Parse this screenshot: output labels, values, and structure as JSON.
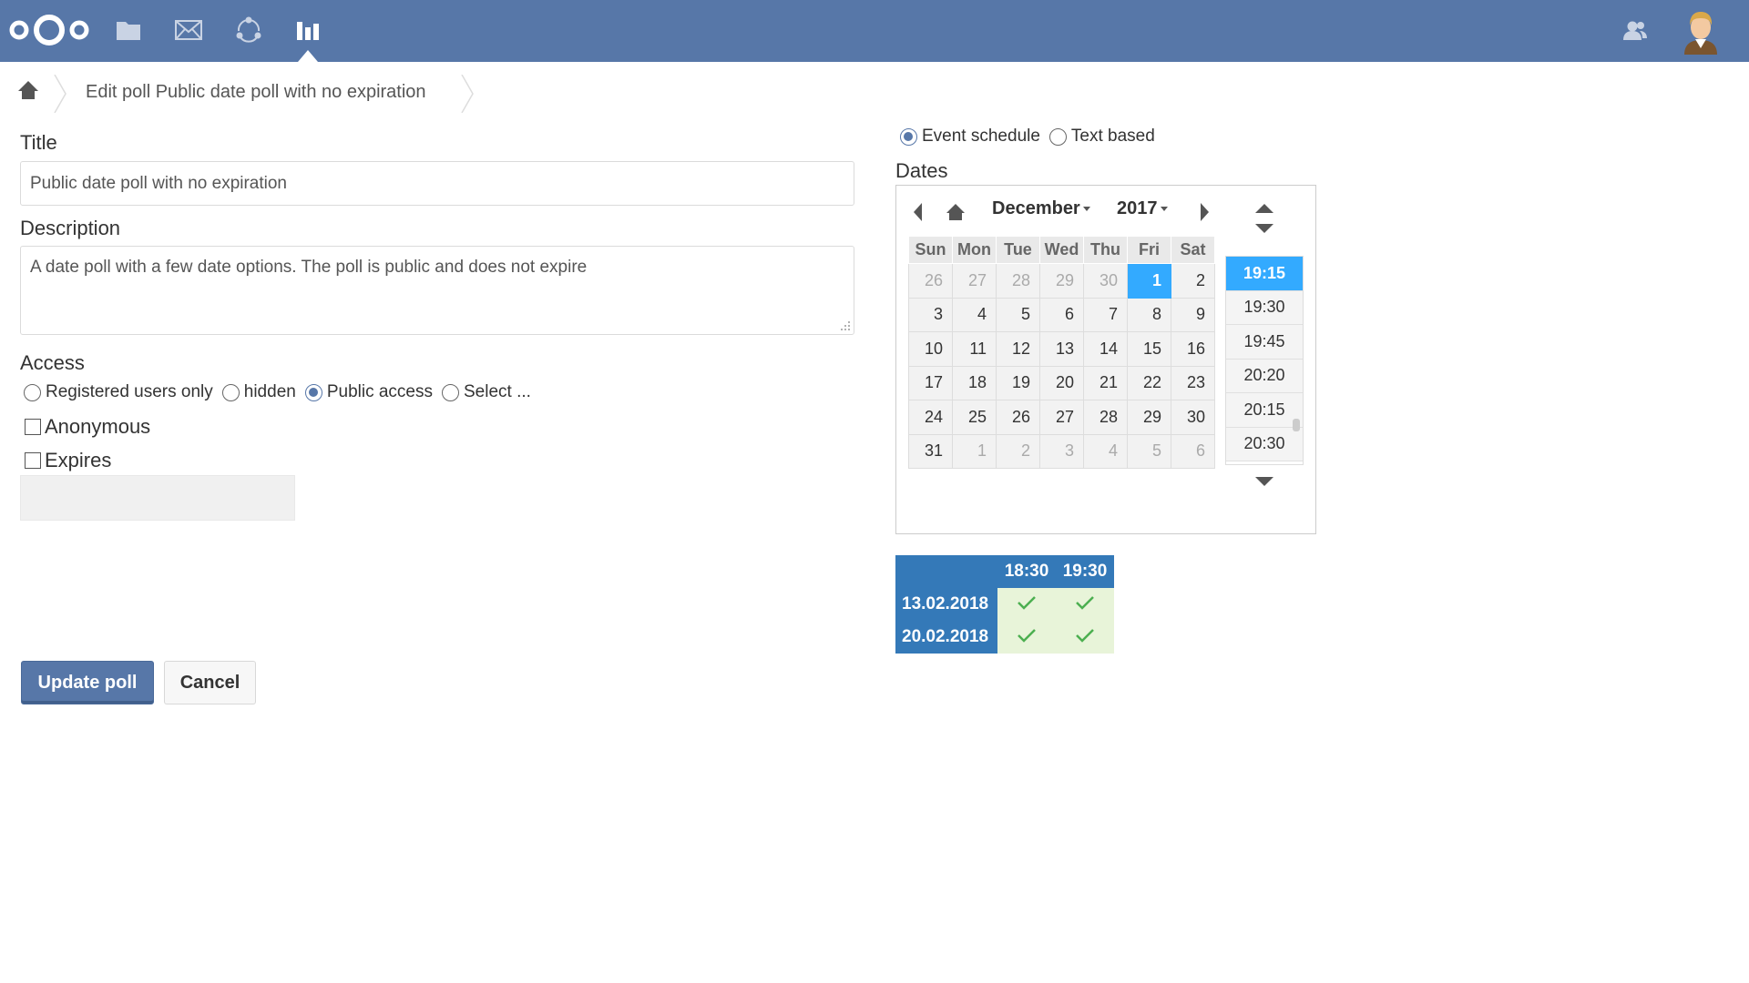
{
  "header": {
    "apps": [
      {
        "name": "Files",
        "icon": "folder-icon"
      },
      {
        "name": "Mail",
        "icon": "mail-icon"
      },
      {
        "name": "Circles",
        "icon": "circles-icon"
      },
      {
        "name": "Polls",
        "icon": "polls-icon",
        "active": true
      }
    ],
    "colors": {
      "header_bg": "#5777a8",
      "accent": "#0082c9",
      "selection": "#33aaff",
      "summary_bg": "#3479b8",
      "ok_bg": "#e8f4d9",
      "ok_check": "#4caf50"
    }
  },
  "breadcrumb": {
    "title": "Edit poll Public date poll with no expiration"
  },
  "form": {
    "title_label": "Title",
    "title_value": "Public date poll with no expiration",
    "description_label": "Description",
    "description_value": "A date poll with a few date options. The poll is public and does not expire",
    "access_label": "Access",
    "access_options": [
      "Registered users only",
      "hidden",
      "Public access",
      "Select ..."
    ],
    "access_selected": "Public access",
    "anonymous_label": "Anonymous",
    "anonymous_checked": false,
    "expires_label": "Expires",
    "expires_checked": false,
    "update_button": "Update poll",
    "cancel_button": "Cancel"
  },
  "poll_type": {
    "options": [
      "Event schedule",
      "Text based"
    ],
    "selected": "Event schedule"
  },
  "dates": {
    "label": "Dates",
    "month": "December",
    "year": "2017",
    "weekdays": [
      "Sun",
      "Mon",
      "Tue",
      "Wed",
      "Thu",
      "Fri",
      "Sat"
    ],
    "weeks": [
      [
        "26",
        "27",
        "28",
        "29",
        "30",
        "1",
        "2"
      ],
      [
        "3",
        "4",
        "5",
        "6",
        "7",
        "8",
        "9"
      ],
      [
        "10",
        "11",
        "12",
        "13",
        "14",
        "15",
        "16"
      ],
      [
        "17",
        "18",
        "19",
        "20",
        "21",
        "22",
        "23"
      ],
      [
        "24",
        "25",
        "26",
        "27",
        "28",
        "29",
        "30"
      ],
      [
        "31",
        "1",
        "2",
        "3",
        "4",
        "5",
        "6"
      ]
    ],
    "selected_day": "1",
    "times": [
      "19:15",
      "19:30",
      "19:45",
      "20:20",
      "20:15",
      "20:30"
    ],
    "selected_time": "19:15"
  },
  "summary": {
    "times": [
      "18:30",
      "19:30"
    ],
    "rows": [
      {
        "date": "13.02.2018",
        "marks": [
          "check-icon",
          "check-icon"
        ]
      },
      {
        "date": "20.02.2018",
        "marks": [
          "check-icon",
          "check-icon"
        ]
      }
    ]
  }
}
